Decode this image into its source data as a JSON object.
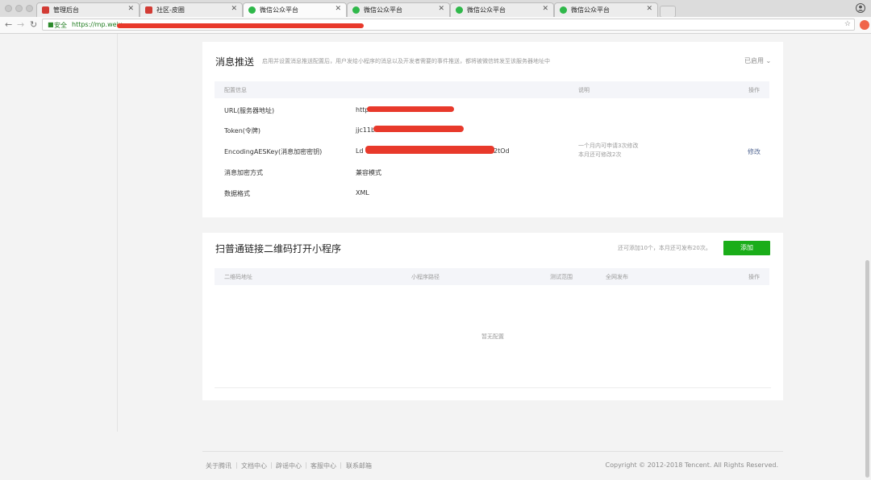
{
  "browser": {
    "tabs": [
      {
        "label": "管理后台",
        "icon": "red",
        "active": false
      },
      {
        "label": "社区-皮圈",
        "icon": "red",
        "active": false
      },
      {
        "label": "微信公众平台",
        "icon": "wx",
        "active": true
      },
      {
        "label": "微信公众平台",
        "icon": "wx",
        "active": false
      },
      {
        "label": "微信公众平台",
        "icon": "wx",
        "active": false
      },
      {
        "label": "微信公众平台",
        "icon": "wx",
        "active": false
      }
    ],
    "secure_label": "安全",
    "url": "https://mp.weix"
  },
  "message_push": {
    "title": "消息推送",
    "description": "启用并设置消息推送配置后，用户发给小程序的消息以及开发者需要的事件推送，都将被微信转发至该服务器地址中",
    "status": "已启用",
    "headers": {
      "config": "配置信息",
      "explain": "说明",
      "operation": "操作"
    },
    "rows": [
      {
        "label": "URL(服务器地址)",
        "value": "http"
      },
      {
        "label": "Token(令牌)",
        "value": "jjc11b"
      },
      {
        "label": "EncodingAESKey(消息加密密钥)",
        "value": "Ld",
        "value_tail": "2tOd",
        "note1": "一个月内可申请3次修改",
        "note2": "本月还可修改2次",
        "action": "修改"
      },
      {
        "label": "消息加密方式",
        "value": "兼容模式"
      },
      {
        "label": "数据格式",
        "value": "XML"
      }
    ]
  },
  "qrcode": {
    "title": "扫普通链接二维码打开小程序",
    "quota": "还可添加10个，本月还可发布20次。",
    "add_button": "添加",
    "headers": {
      "address": "二维码地址",
      "path": "小程序路径",
      "test_range": "测试范围",
      "publish": "全网发布",
      "operation": "操作"
    },
    "empty": "暂无配置"
  },
  "footer": {
    "links": [
      "关于腾讯",
      "文档中心",
      "辟谣中心",
      "客服中心",
      "联系邮箱"
    ],
    "copyright": "Copyright © 2012-2018 Tencent. All Rights Reserved."
  },
  "colors": {
    "accent_green": "#1aad19",
    "link": "#576b95",
    "redaction": "#e8392b"
  }
}
